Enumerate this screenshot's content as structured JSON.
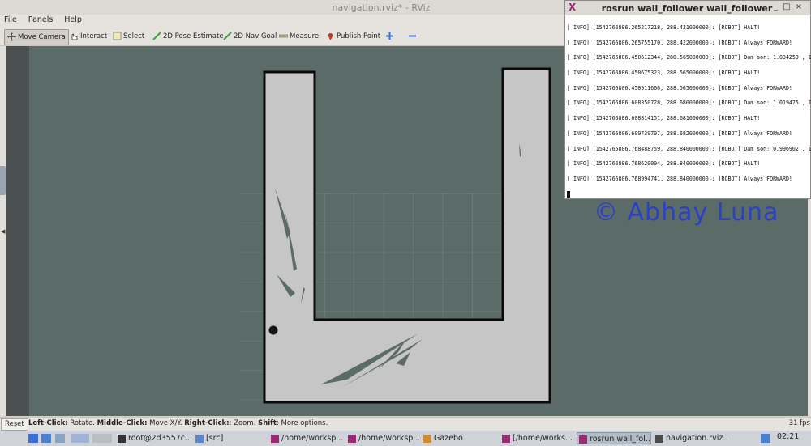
{
  "window": {
    "title": "navigation.rviz* - RViz"
  },
  "menu": [
    "File",
    "Panels",
    "Help"
  ],
  "toolbar": {
    "tools": [
      {
        "label": "Move Camera",
        "icon": "move-camera-icon"
      },
      {
        "label": "Interact",
        "icon": "interact-icon"
      },
      {
        "label": "Select",
        "icon": "select-icon"
      },
      {
        "label": "2D Pose Estimate",
        "icon": "pose-estimate-icon"
      },
      {
        "label": "2D Nav Goal",
        "icon": "nav-goal-icon"
      },
      {
        "label": "Measure",
        "icon": "measure-icon"
      },
      {
        "label": "Publish Point",
        "icon": "publish-point-icon"
      }
    ],
    "active_tool": "Move Camera"
  },
  "terminal": {
    "title": "rosrun wall_follower wall_follower",
    "lines": [
      "[ INFO] [1542766806.265217218, 288.421000000]: [ROBOT] HALT!",
      "[ INFO] [1542766806.265755170, 288.422000000]: [ROBOT] Always FORWARD!",
      "[ INFO] [1542766806.450612344, 288.565000000]: [ROBOT] Dam son: 1.034259 , 1",
      "[ INFO] [1542766806.450675323, 288.565000000]: [ROBOT] HALT!",
      "[ INFO] [1542766806.450911666, 288.565000000]: [ROBOT] Always FORWARD!",
      "[ INFO] [1542766806.608350728, 288.680000000]: [ROBOT] Dam son: 1.019475 , 1",
      "[ INFO] [1542766806.608814151, 288.681000000]: [ROBOT] HALT!",
      "[ INFO] [1542766806.609739707, 288.682000000]: [ROBOT] Always FORWARD!",
      "[ INFO] [1542766806.768488759, 288.840000000]: [ROBOT] Dam son: 0.996902 , 1",
      "[ INFO] [1542766806.768620094, 288.840000000]: [ROBOT] HALT!",
      "[ INFO] [1542766806.768994741, 288.840000000]: [ROBOT] Always FORWARD!"
    ]
  },
  "watermark": "© Abhay Luna",
  "status": {
    "reset_label": "Reset",
    "hints": [
      {
        "key": "Left-Click:",
        "action": " Rotate. "
      },
      {
        "key": "Middle-Click:",
        "action": " Move X/Y. "
      },
      {
        "key": "Right-Click:",
        "action": ": Zoom. "
      },
      {
        "key": "Shift",
        "action": ": More options."
      }
    ],
    "fps": "31 fps"
  },
  "taskbar": {
    "tasks": [
      {
        "label": "root@2d3557c...",
        "icon": "terminal-icon"
      },
      {
        "label": "[src]",
        "icon": "folder-icon"
      },
      {
        "label": "/home/worksp...",
        "icon": "xterm-icon"
      },
      {
        "label": "/home/worksp...",
        "icon": "xterm-icon"
      },
      {
        "label": "Gazebo",
        "icon": "gazebo-icon"
      },
      {
        "label": "[/home/works...",
        "icon": "xterm-icon"
      },
      {
        "label": "rosrun wall_fol...",
        "icon": "xterm-icon",
        "active": true
      },
      {
        "label": "navigation.rviz...",
        "icon": "rviz-icon"
      }
    ],
    "clock": "02:21"
  },
  "colors": {
    "viewport_bg": "#5b6b68",
    "map_free": "#c6c6c6",
    "map_wall": "#0a0a0a",
    "accent_task": "#9a2a73"
  }
}
